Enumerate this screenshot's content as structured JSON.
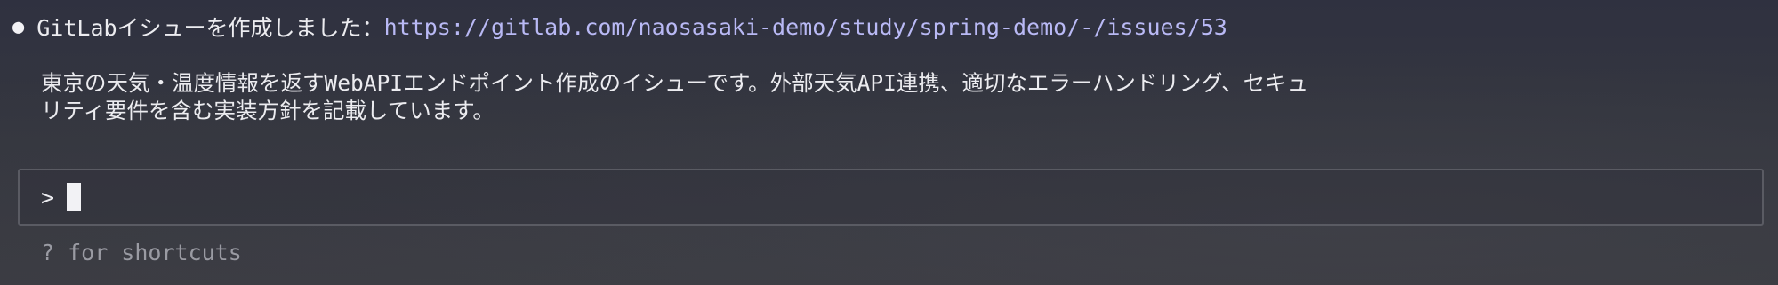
{
  "status": {
    "bullet": "●",
    "message": "GitLabイシューを作成しました：",
    "issue_url": "https://gitlab.com/naosasaki-demo/study/spring-demo/-/issues/53"
  },
  "summary": {
    "text": "東京の天気・温度情報を返すWebAPIエンドポイント作成のイシューです。外部天気API連携、適切なエラーハンドリング、セキュ\nリティ要件を含む実装方針を記載しています。"
  },
  "prompt": {
    "symbol": ">",
    "value": ""
  },
  "hint": {
    "text": "? for shortcuts"
  }
}
